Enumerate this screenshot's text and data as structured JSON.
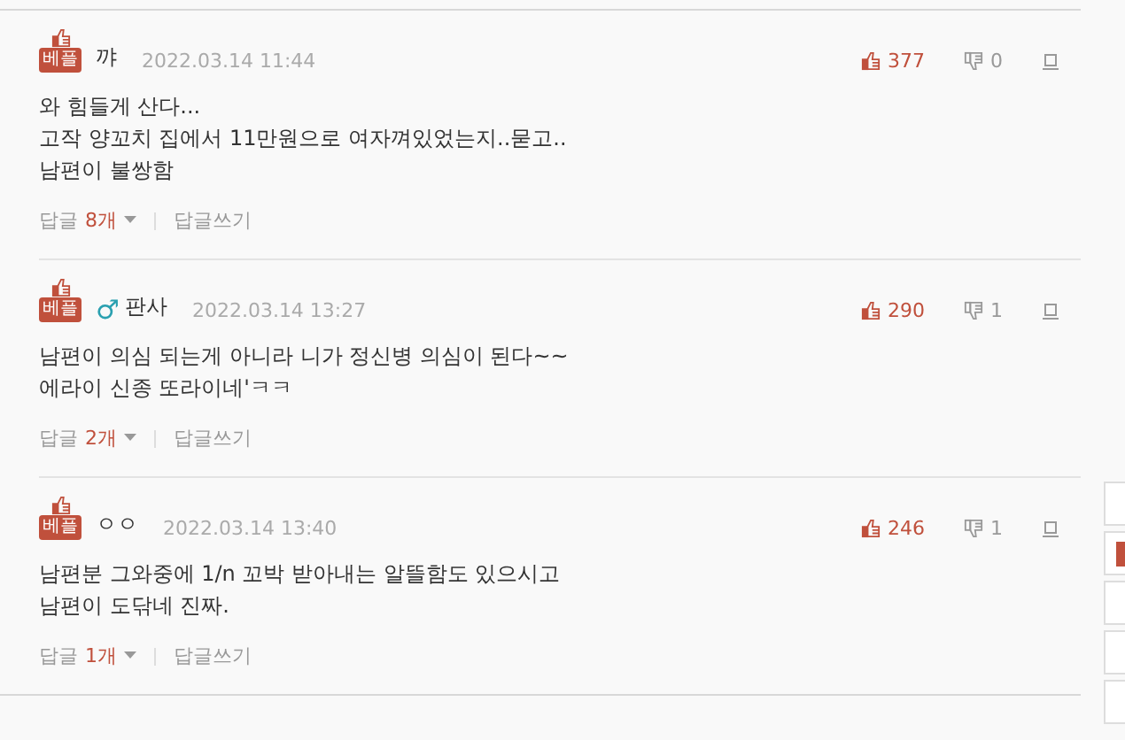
{
  "comments": [
    {
      "badge": "베플",
      "author": "꺄",
      "date": "2022.03.14 11:44",
      "likes": "377",
      "dislikes": "0",
      "lines": [
        "와 힘들게 산다...",
        "고작 양꼬치 집에서 11만원으로 여자껴있었는지..묻고..",
        "남편이 불쌍함"
      ],
      "replies_label": "답글",
      "replies_count": "8개",
      "write_reply": "답글쓰기"
    },
    {
      "badge": "베플",
      "gender_mark": "♂",
      "author": "판사",
      "date": "2022.03.14 13:27",
      "likes": "290",
      "dislikes": "1",
      "lines": [
        "남편이 의심 되는게 아니라 니가 정신병 의심이 된다~~",
        "에라이 신종 또라이네'ㅋㅋ"
      ],
      "replies_label": "답글",
      "replies_count": "2개",
      "write_reply": "답글쓰기"
    },
    {
      "badge": "베플",
      "author": "ㅇㅇ",
      "date": "2022.03.14 13:40",
      "likes": "246",
      "dislikes": "1",
      "lines": [
        "남편분 그와중에 1/n 꼬박 받아내는 알뜰함도 있으시고",
        "남편이 도닦네 진짜."
      ],
      "replies_label": "답글",
      "replies_count": "1개",
      "write_reply": "답글쓰기"
    }
  ]
}
